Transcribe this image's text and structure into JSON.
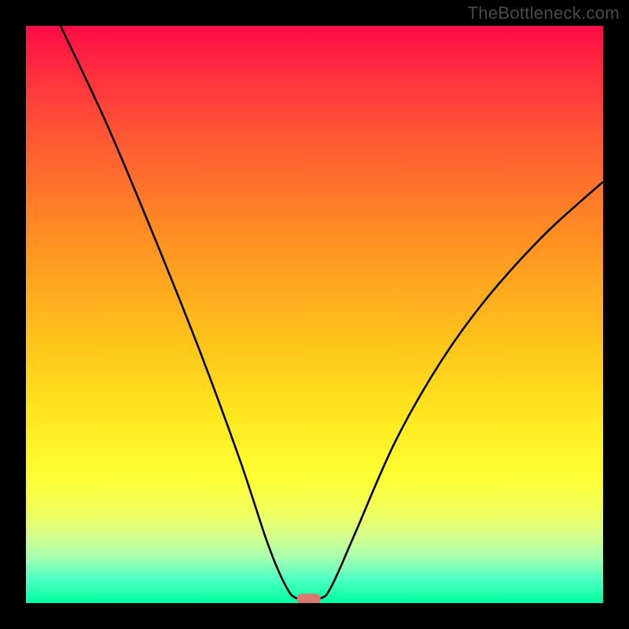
{
  "watermark": "TheBottleneck.com",
  "chart_data": {
    "type": "line",
    "title": "",
    "xlabel": "",
    "ylabel": "",
    "xlim": [
      0,
      100
    ],
    "ylim": [
      0,
      100
    ],
    "series": [
      {
        "name": "bottleneck-curve",
        "points": [
          {
            "x": 6,
            "y": 100
          },
          {
            "x": 14,
            "y": 83
          },
          {
            "x": 22,
            "y": 64
          },
          {
            "x": 30,
            "y": 44
          },
          {
            "x": 37,
            "y": 25
          },
          {
            "x": 42,
            "y": 10
          },
          {
            "x": 45,
            "y": 3
          },
          {
            "x": 47,
            "y": 0.8
          },
          {
            "x": 51,
            "y": 0.8
          },
          {
            "x": 53,
            "y": 3
          },
          {
            "x": 57,
            "y": 12
          },
          {
            "x": 64,
            "y": 28
          },
          {
            "x": 72,
            "y": 42
          },
          {
            "x": 80,
            "y": 53
          },
          {
            "x": 90,
            "y": 64
          },
          {
            "x": 100,
            "y": 73
          }
        ]
      }
    ],
    "marker": {
      "name": "optimal-point",
      "x": 49,
      "y": 0.8,
      "color": "#d9786e"
    },
    "background": {
      "type": "vertical-gradient",
      "stops": [
        {
          "pos": 0,
          "color": "#ff0b46"
        },
        {
          "pos": 50,
          "color": "#ffb81f"
        },
        {
          "pos": 80,
          "color": "#feff33"
        },
        {
          "pos": 100,
          "color": "#00ffa2"
        }
      ]
    }
  }
}
